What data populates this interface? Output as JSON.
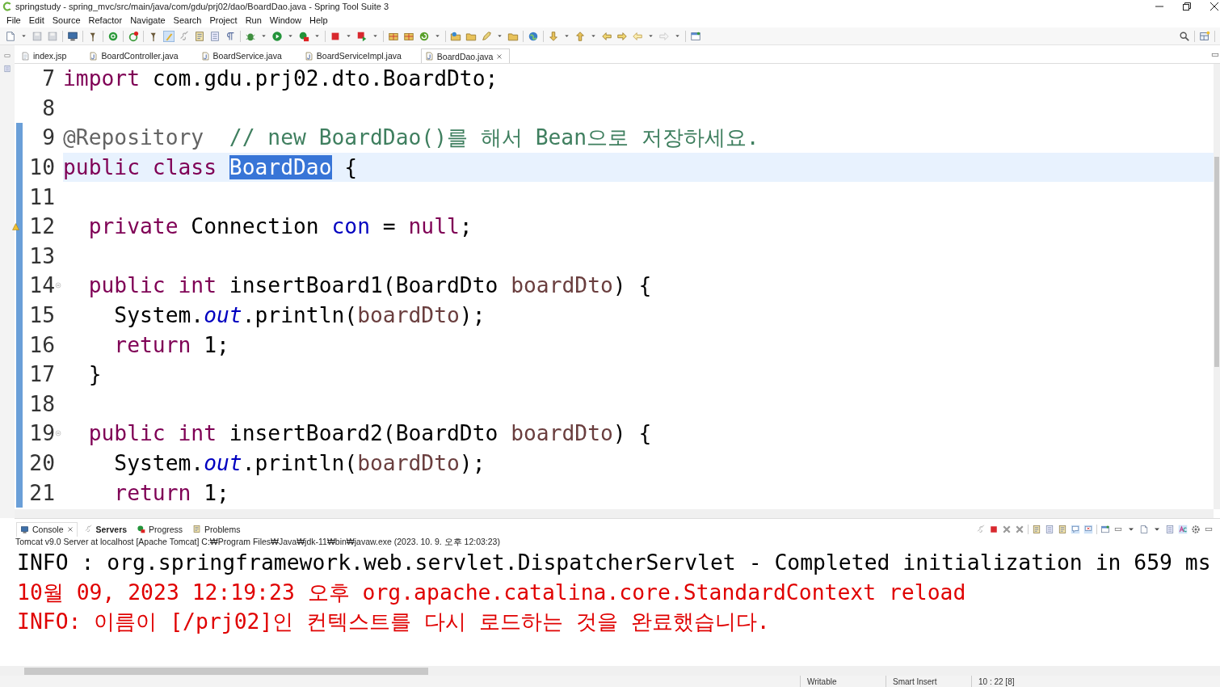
{
  "window": {
    "title": "springstudy - spring_mvc/src/main/java/com/gdu/prj02/dao/BoardDao.java - Spring Tool Suite 3"
  },
  "menu": [
    "File",
    "Edit",
    "Source",
    "Refactor",
    "Navigate",
    "Search",
    "Project",
    "Run",
    "Window",
    "Help"
  ],
  "tabs": [
    {
      "label": "index.jsp",
      "kind": "jsp",
      "selected": false
    },
    {
      "label": "BoardController.java",
      "kind": "java",
      "selected": false
    },
    {
      "label": "BoardService.java",
      "kind": "java",
      "selected": false
    },
    {
      "label": "BoardServiceImpl.java",
      "kind": "java",
      "selected": false
    },
    {
      "label": "BoardDao.java",
      "kind": "java",
      "selected": true
    }
  ],
  "lines": [
    {
      "number": "7",
      "changed": false,
      "current": false,
      "foldable": false,
      "warning": false,
      "tokens": [
        {
          "text": "import",
          "kind": "keyword"
        },
        {
          "text": " com.gdu.prj02.dto.BoardDto;",
          "kind": "plain"
        }
      ]
    },
    {
      "number": "8",
      "changed": false,
      "current": false,
      "foldable": false,
      "warning": false
    },
    {
      "number": "9",
      "changed": true,
      "current": false,
      "foldable": false,
      "warning": false,
      "tokens": [
        {
          "text": "@Repository  ",
          "kind": "annotation"
        },
        {
          "text": "// new BoardDao()를 해서 Bean으로 저장하세요.",
          "kind": "comment"
        }
      ]
    },
    {
      "number": "10",
      "changed": true,
      "current": true,
      "foldable": false,
      "warning": false,
      "tokens": [
        {
          "text": "public class ",
          "kind": "keyword"
        },
        {
          "text": "BoardDao",
          "kind": "selected"
        },
        {
          "text": " {",
          "kind": "plain"
        }
      ]
    },
    {
      "number": "11",
      "changed": true,
      "current": false,
      "foldable": false,
      "warning": false
    },
    {
      "number": "12",
      "changed": true,
      "current": false,
      "foldable": false,
      "warning": true,
      "tokens": [
        {
          "text": "  private",
          "kind": "keyword"
        },
        {
          "text": " Connection ",
          "kind": "plain"
        },
        {
          "text": "con",
          "kind": "field"
        },
        {
          "text": " = ",
          "kind": "plain"
        },
        {
          "text": "null",
          "kind": "keyword"
        },
        {
          "text": ";",
          "kind": "plain"
        }
      ]
    },
    {
      "number": "13",
      "changed": true,
      "current": false,
      "foldable": false,
      "warning": false
    },
    {
      "number": "14",
      "changed": true,
      "current": false,
      "foldable": true,
      "warning": false,
      "tokens": [
        {
          "text": "  public int",
          "kind": "keyword"
        },
        {
          "text": " insertBoard1(BoardDto ",
          "kind": "plain"
        },
        {
          "text": "boardDto",
          "kind": "param"
        },
        {
          "text": ") {",
          "kind": "plain"
        }
      ]
    },
    {
      "number": "15",
      "changed": true,
      "current": false,
      "foldable": false,
      "warning": false,
      "tokens": [
        {
          "text": "    System.",
          "kind": "plain"
        },
        {
          "text": "out",
          "kind": "static"
        },
        {
          "text": ".println(",
          "kind": "plain"
        },
        {
          "text": "boardDto",
          "kind": "param"
        },
        {
          "text": ");",
          "kind": "plain"
        }
      ]
    },
    {
      "number": "16",
      "changed": true,
      "current": false,
      "foldable": false,
      "warning": false,
      "tokens": [
        {
          "text": "    return",
          "kind": "keyword"
        },
        {
          "text": " 1;",
          "kind": "plain"
        }
      ]
    },
    {
      "number": "17",
      "changed": true,
      "current": false,
      "foldable": false,
      "warning": false,
      "tokens": [
        {
          "text": "  }",
          "kind": "plain"
        }
      ]
    },
    {
      "number": "18",
      "changed": true,
      "current": false,
      "foldable": false,
      "warning": false
    },
    {
      "number": "19",
      "changed": true,
      "current": false,
      "foldable": true,
      "warning": false,
      "tokens": [
        {
          "text": "  public int",
          "kind": "keyword"
        },
        {
          "text": " insertBoard2(BoardDto ",
          "kind": "plain"
        },
        {
          "text": "boardDto",
          "kind": "param"
        },
        {
          "text": ") {",
          "kind": "plain"
        }
      ]
    },
    {
      "number": "20",
      "changed": true,
      "current": false,
      "foldable": false,
      "warning": false,
      "tokens": [
        {
          "text": "    System.",
          "kind": "plain"
        },
        {
          "text": "out",
          "kind": "static"
        },
        {
          "text": ".println(",
          "kind": "plain"
        },
        {
          "text": "boardDto",
          "kind": "param"
        },
        {
          "text": ");",
          "kind": "plain"
        }
      ]
    },
    {
      "number": "21",
      "changed": true,
      "current": false,
      "foldable": false,
      "warning": false,
      "tokens": [
        {
          "text": "    return",
          "kind": "keyword"
        },
        {
          "text": " 1;",
          "kind": "plain"
        }
      ]
    }
  ],
  "console_tabs": [
    {
      "label": "Console",
      "selected": true,
      "highlighted": false
    },
    {
      "label": "Servers",
      "selected": false,
      "highlighted": true
    },
    {
      "label": "Progress",
      "selected": false,
      "highlighted": false
    },
    {
      "label": "Problems",
      "selected": false,
      "highlighted": false
    }
  ],
  "console_process": "Tomcat v9.0 Server at localhost [Apache Tomcat] C:₩Program Files₩Java₩jdk-11₩bin₩javaw.exe  (2023. 10. 9. 오후 12:03:23)",
  "console_lines": [
    {
      "text": "INFO : org.springframework.web.servlet.DispatcherServlet - Completed initialization in 659 ms",
      "kind": "stdout"
    },
    {
      "text": "10월 09, 2023 12:19:23 오후 org.apache.catalina.core.StandardContext reload",
      "kind": "stderr"
    },
    {
      "text": "INFO: 이름이 [/prj02]인 컨텍스트를 다시 로드하는 것을 완료했습니다.",
      "kind": "stderr"
    }
  ],
  "status_bar": [
    "Writable",
    "Smart Insert",
    "10 : 22 [8]"
  ]
}
